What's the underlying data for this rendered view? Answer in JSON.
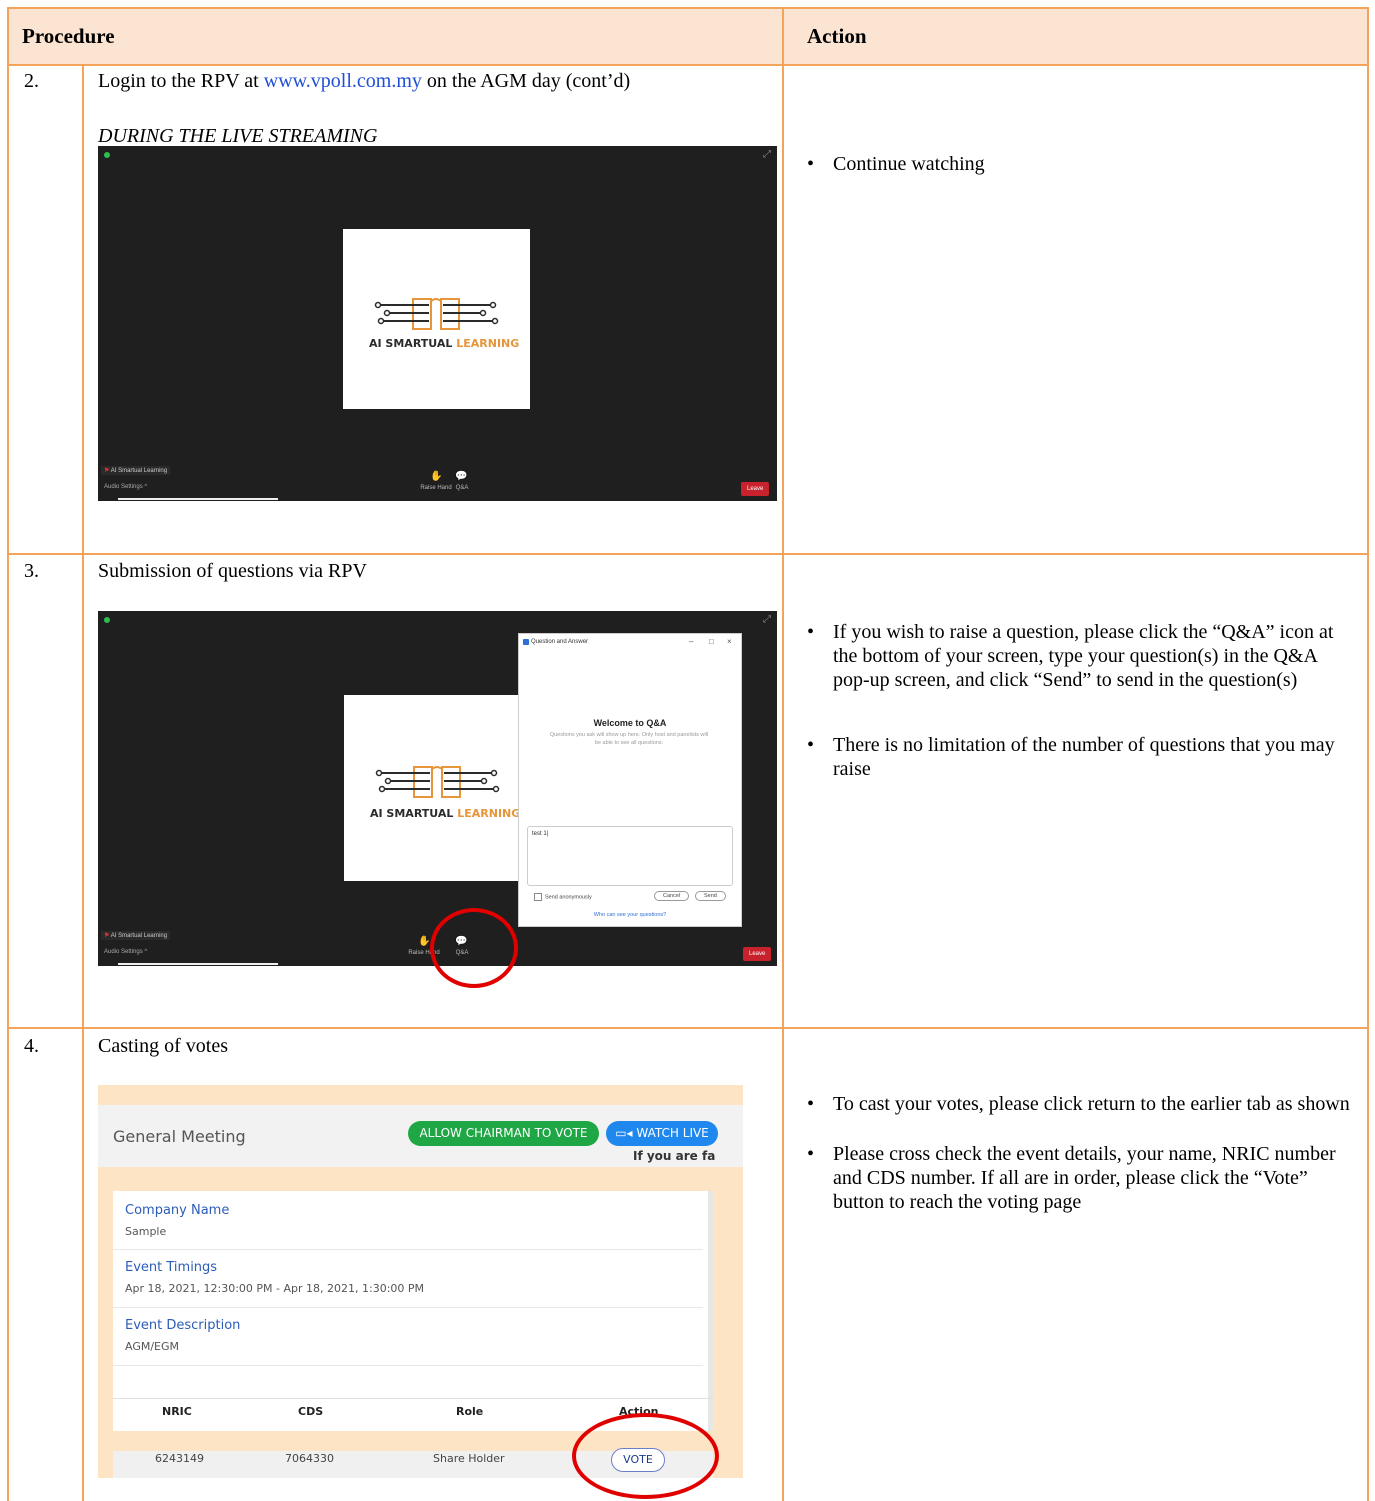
{
  "header": {
    "procedure": "Procedure",
    "action": "Action"
  },
  "rows": [
    {
      "num": "2.",
      "title_pre": "Login to the RPV at ",
      "title_link": "www.vpoll.com.my",
      "title_post": " on the AGM day (cont’d)",
      "subtitle": "DURING THE LIVE STREAMING",
      "bullets": [
        "Continue watching"
      ]
    },
    {
      "num": "3.",
      "title": "Submission of questions via RPV",
      "bullets": [
        "If you wish to raise a question, please click the “Q&A” icon at the bottom of your screen, type your question(s) in the Q&A pop-up screen, and click “Send” to send in the question(s)",
        "There is no limitation of the number of questions that you may raise"
      ]
    },
    {
      "num": "4.",
      "title": "Casting of votes",
      "bullets": [
        "To cast your votes, please click return to the earlier tab as shown",
        "Please cross check the event details, your name, NRIC number and CDS number. If all are in order, please click the “Vote” button to reach the voting page"
      ]
    }
  ],
  "zoom": {
    "logo_main": "AI SMARTUAL ",
    "logo_accent": "LEARNING",
    "participant": "AI Smartual Learning",
    "audio": "Audio Settings ^",
    "raise_hand": "Raise Hand",
    "qa": "Q&A",
    "leave": "Leave"
  },
  "qa_dialog": {
    "title": "Question and Answer",
    "welcome": "Welcome to Q&A",
    "desc": "Questions you ask will show up here. Only host and panelists will be able to see all questions.",
    "input": "test 1|",
    "anon": "Send anonymously",
    "cancel": "Cancel",
    "send": "Send",
    "footer": "Who can see your questions?"
  },
  "vpoll": {
    "title": "General Meeting",
    "allow": "ALLOW CHAIRMAN TO VOTE",
    "watch": "WATCH LIVE",
    "cut": "If you are fa",
    "company_label": "Company Name",
    "company_value": "Sample",
    "timing_label": "Event Timings",
    "timing_value": "Apr 18, 2021, 12:30:00 PM - Apr 18, 2021, 1:30:00 PM",
    "desc_label": "Event Description",
    "desc_value": "AGM/EGM",
    "table_headers": [
      "NRIC",
      "CDS",
      "Role",
      "Action"
    ],
    "table_row": [
      "6243149",
      "7064330",
      "Share Holder"
    ],
    "vote": "VOTE"
  },
  "colors": {
    "border": "#f3a35a",
    "header_bg": "#fbe4d2",
    "highlight": "#e00000",
    "accent": "#e6953a"
  }
}
